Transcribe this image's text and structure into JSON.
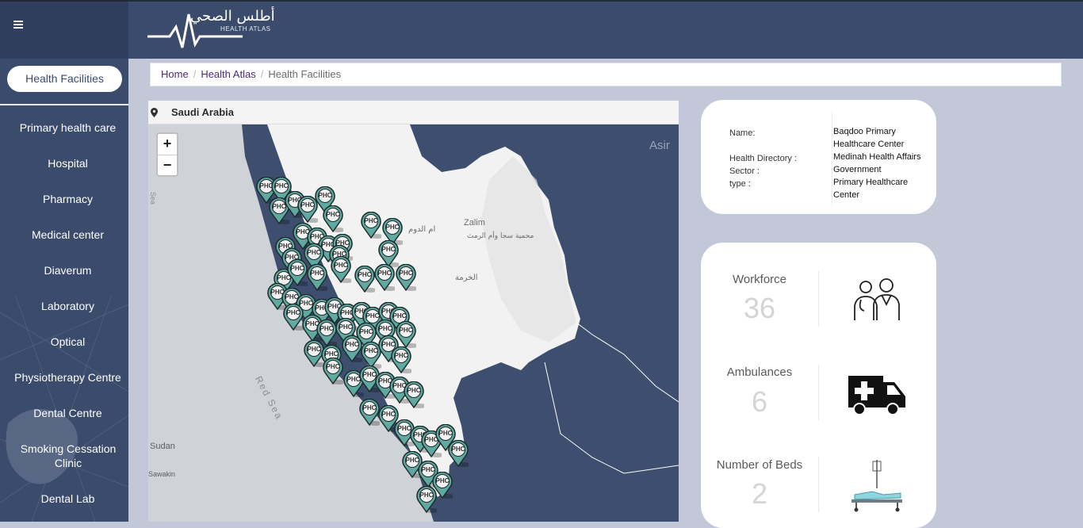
{
  "header": {
    "logo_arabic": "أطلس الصحي",
    "logo_english": "HEALTH ATLAS",
    "menu_icon": "hamburger-icon"
  },
  "sidebar": {
    "active_filter": "Health Facilities",
    "items": [
      {
        "label": "Primary health care"
      },
      {
        "label": "Hospital"
      },
      {
        "label": "Pharmacy"
      },
      {
        "label": "Medical center"
      },
      {
        "label": "Diaverum"
      },
      {
        "label": "Laboratory"
      },
      {
        "label": "Optical"
      },
      {
        "label": "Physiotherapy Centre"
      },
      {
        "label": "Dental Centre"
      },
      {
        "label": "Smoking Cessation Clinic"
      },
      {
        "label": "Dental Lab"
      }
    ]
  },
  "breadcrumb": {
    "home": "Home",
    "atlas": "Health Atlas",
    "current": "Health Facilities"
  },
  "map": {
    "country": "Saudi Arabia",
    "zoom_in": "+",
    "zoom_out": "−",
    "marker_label": "PHC",
    "labels": {
      "asir": "Asir",
      "zalim": "Zalim",
      "umm_al_dawm": "ام الدوم",
      "reserve": "محمية سجا وأم الرمث",
      "khurmah": "الخرمة",
      "red_sea": "Red Sea",
      "sudan": "Sudan",
      "suakin": "Sawakin",
      "sea_edge": "Sea"
    }
  },
  "facility": {
    "name_key": "Name:",
    "directory_key": "Health Directory :",
    "sector_key": "Sector :",
    "type_key": "type :",
    "name": "Baqdoo Primary Healthcare Center",
    "directory": "Medinah Health Affairs",
    "sector": "Government",
    "type": "Primary Healthcare Center"
  },
  "stats": [
    {
      "label": "Workforce",
      "value": "36",
      "icon": "medical-staff-icon"
    },
    {
      "label": "Ambulances",
      "value": "6",
      "icon": "ambulance-icon"
    },
    {
      "label": "Number of Beds",
      "value": "2",
      "icon": "hospital-bed-icon"
    }
  ],
  "colors": {
    "sidebar": "#3a4b6b",
    "map_sea": "#3d4e6f",
    "marker": "#5fa9a0",
    "accent_link": "#4a2a7a"
  }
}
